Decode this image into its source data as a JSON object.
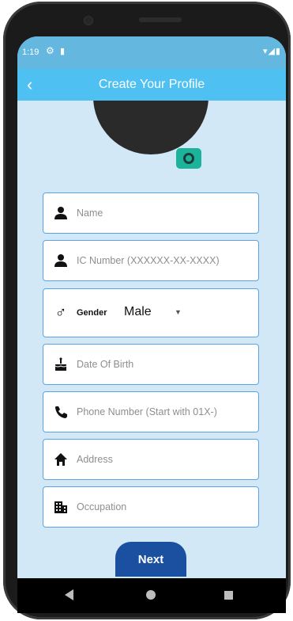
{
  "status_bar": {
    "time": "1:19",
    "gear_icon": "⚙",
    "sd_icon": "▮",
    "right_icons": "▾◢▮"
  },
  "app_bar": {
    "back_icon": "‹",
    "title": "Create Your Profile"
  },
  "form": {
    "name_placeholder": "Name",
    "ic_placeholder": "IC Number (XXXXXX-XX-XXXX)",
    "gender_label": "Gender",
    "gender_value": "Male",
    "gender_caret": "▼",
    "dob_placeholder": "Date Of Birth",
    "phone_placeholder": "Phone Number (Start with 01X-)",
    "address_placeholder": "Address",
    "occupation_placeholder": "Occupation"
  },
  "icons": {
    "person": "👤",
    "gender": "♂",
    "cake": "🎂",
    "phone": "📞",
    "home": "⌂",
    "building": "▦"
  },
  "next_button": "Next",
  "colors": {
    "status_bar": "#64b8e0",
    "app_bar": "#4ec1f2",
    "screen_bg": "#d2e8f7",
    "field_border": "#5aa4e6",
    "next_button": "#1b4fa0",
    "camera_button": "#1bb39a"
  }
}
